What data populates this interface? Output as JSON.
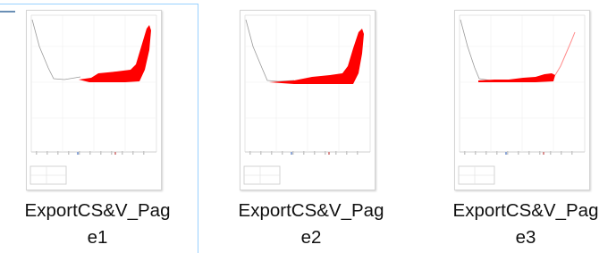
{
  "files": [
    {
      "name_line1": "ExportCS&V_Pag",
      "name_line2": "e1",
      "icon": "pdf-page-thumbnail-icon"
    },
    {
      "name_line1": "ExportCS&V_Pag",
      "name_line2": "e2",
      "icon": "pdf-page-thumbnail-icon"
    },
    {
      "name_line1": "ExportCS&V_Pag",
      "name_line2": "e3",
      "icon": "pdf-page-thumbnail-icon"
    }
  ],
  "colors": {
    "selection_border": "#99d1ff",
    "chart_fill": "#ff0000"
  }
}
